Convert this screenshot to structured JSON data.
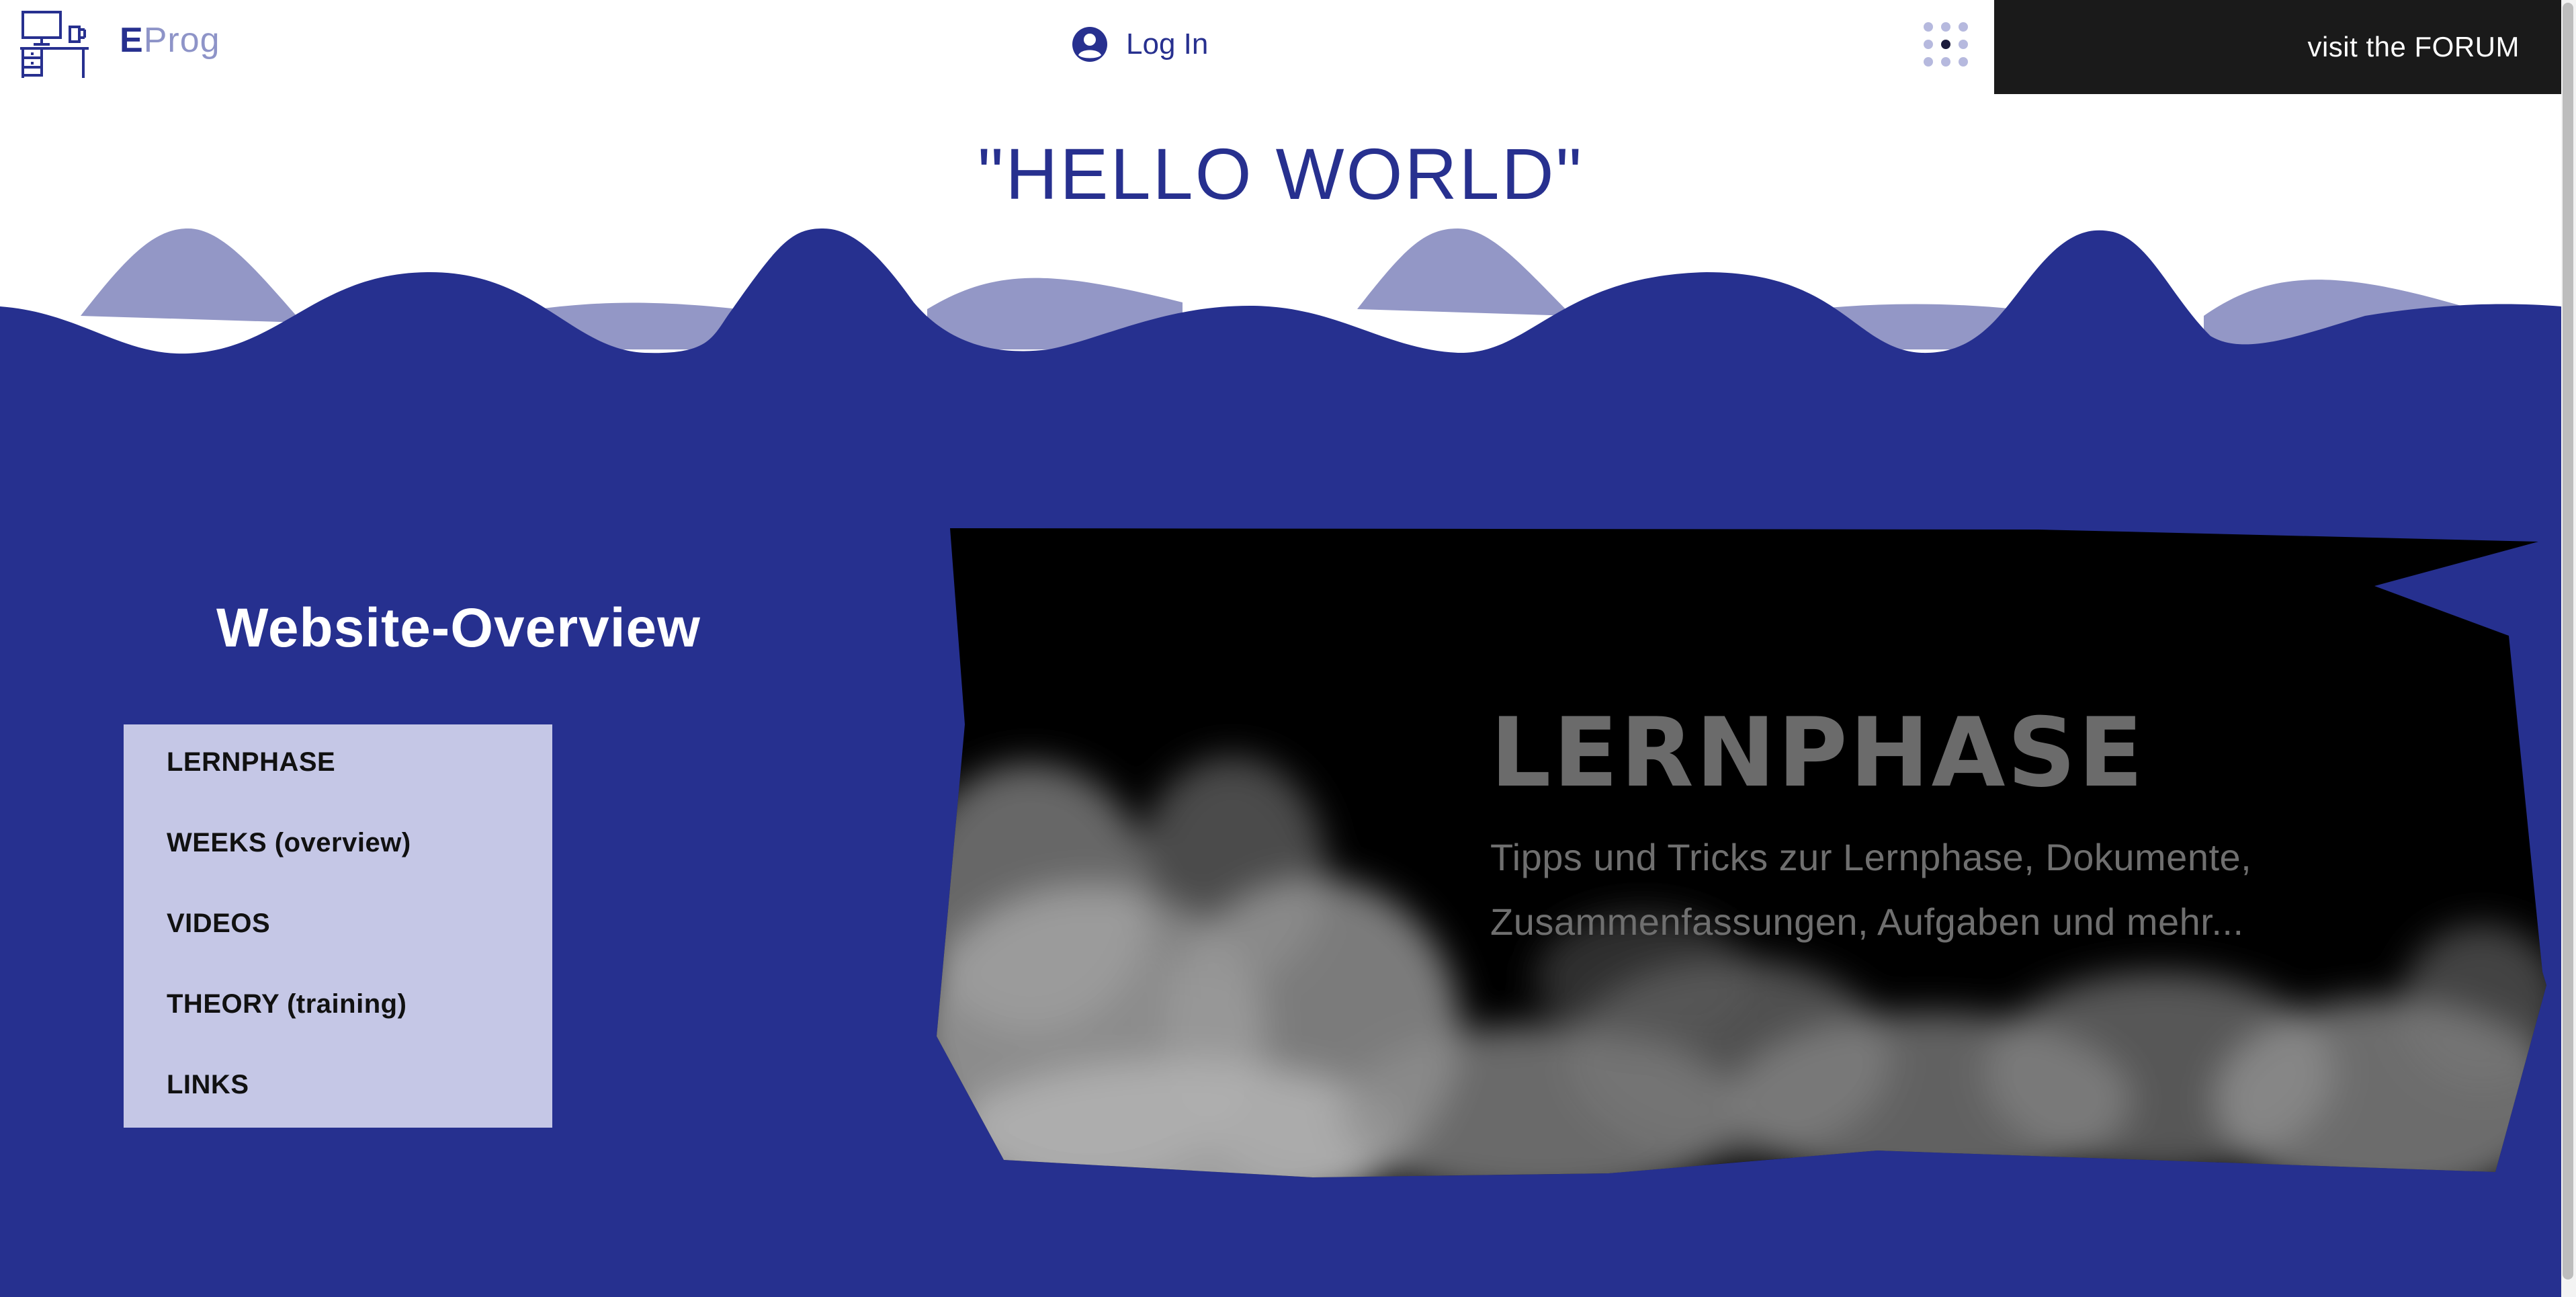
{
  "header": {
    "logo_letter": "E",
    "logo_rest": "Prog",
    "login_label": "Log In",
    "forum_label": "visit the FORUM"
  },
  "hero": {
    "title": "\"HELLO WORLD\""
  },
  "overview": {
    "title": "Website-Overview",
    "items": [
      {
        "label": "LERNPHASE"
      },
      {
        "label": "WEEKS (overview)"
      },
      {
        "label": "VIDEOS"
      },
      {
        "label": "THEORY (training)"
      },
      {
        "label": "LINKS"
      }
    ]
  },
  "feature": {
    "title": "LERNPHASE",
    "description_line1": "Tipps und Tricks zur Lernphase, Dokumente,",
    "description_line2": "Zusammenfassungen, Aufgaben und mehr..."
  },
  "colors": {
    "brand_blue": "#26308f",
    "wave_light": "#9397c6",
    "menu_bg": "#c5c7e6",
    "forum_bg": "#1a1a1a"
  },
  "icons": {
    "logo": "desk-computer-icon",
    "login": "user-circle-icon",
    "apps": "grid-dots-icon"
  }
}
